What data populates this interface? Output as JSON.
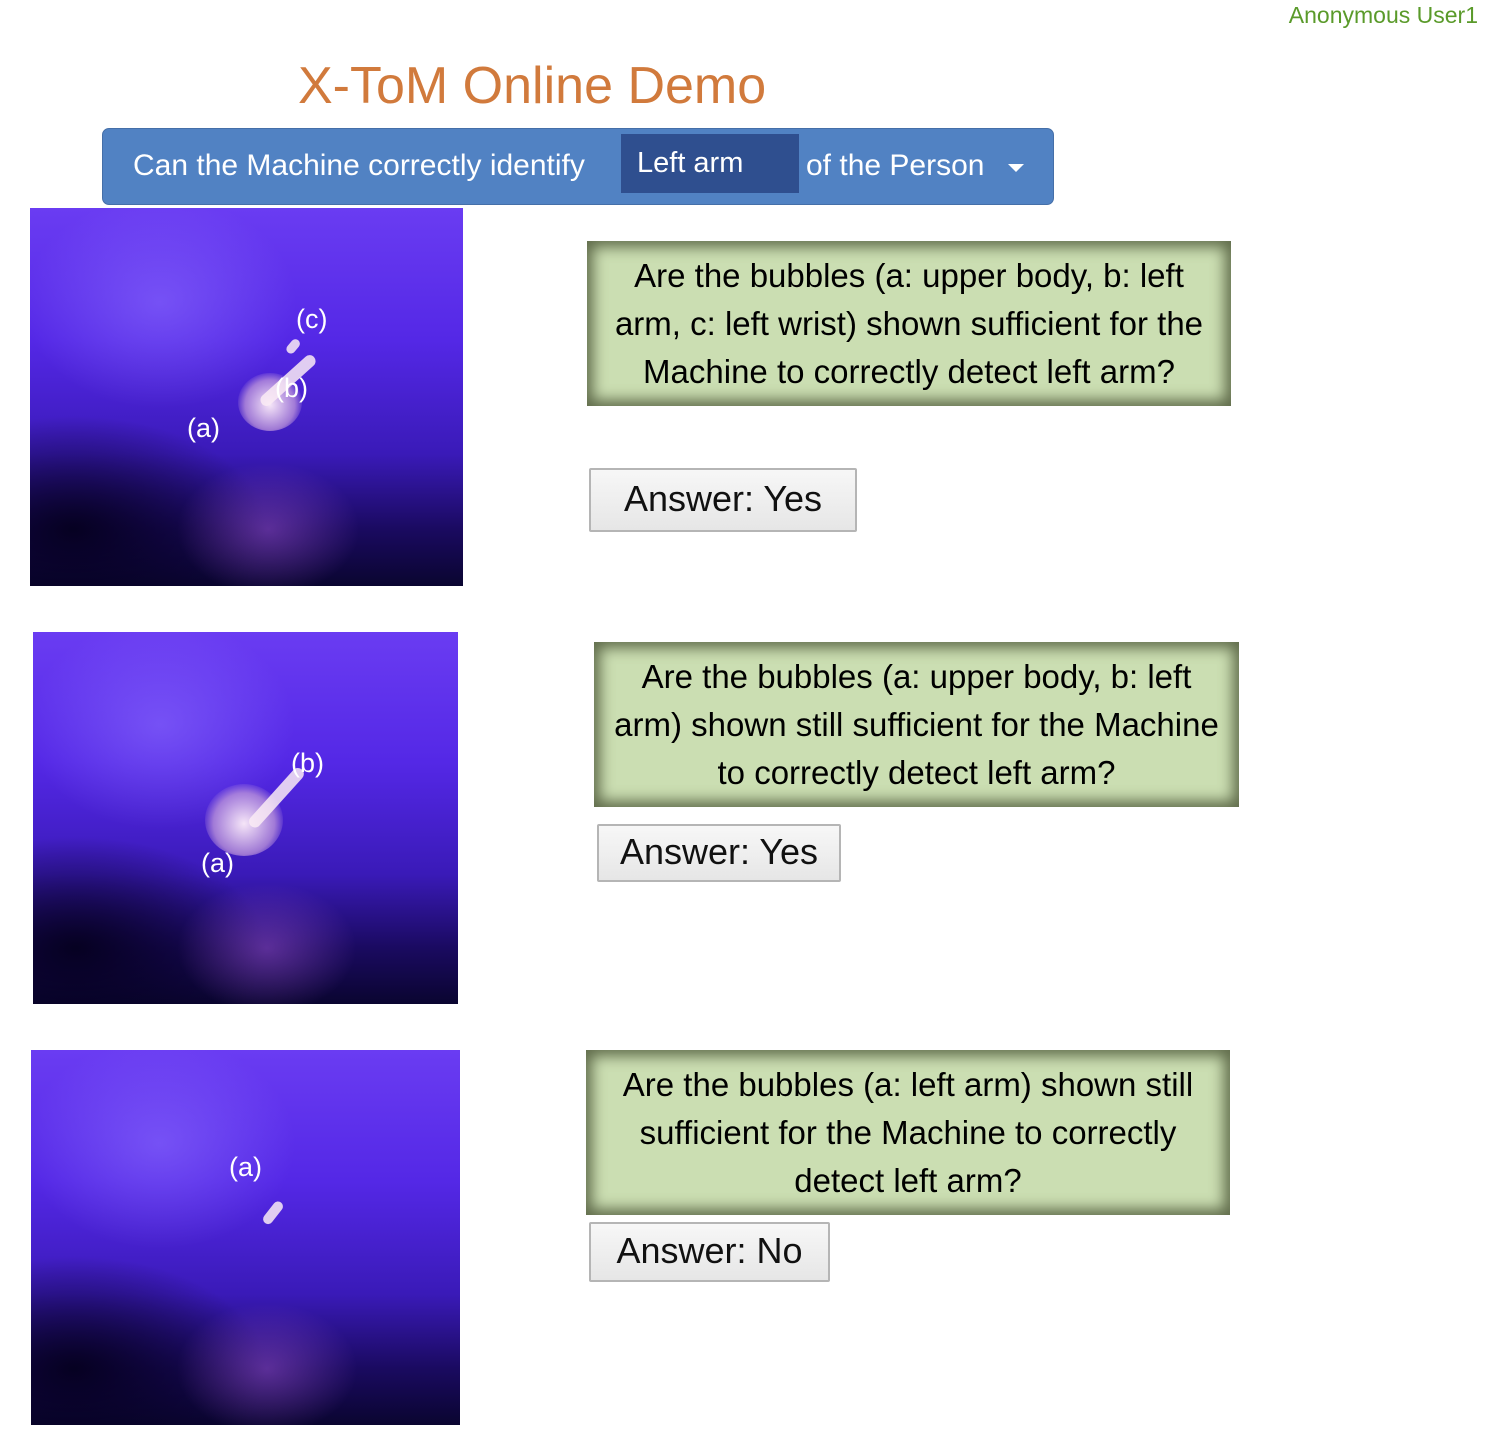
{
  "header": {
    "user": "Anonymous User1",
    "title": "X-ToM Online Demo"
  },
  "query": {
    "prefix": "Can the Machine correctly identify",
    "selected_part": "Left arm",
    "suffix": "of the Person",
    "dropdown_icon": "caret-down-icon"
  },
  "rows": [
    {
      "bubble_labels": [
        "(c)",
        "(b)",
        "(a)"
      ],
      "question": "Are the bubbles (a: upper body, b: left arm, c: left wrist) shown sufficient for the Machine to correctly detect left arm?",
      "answer": "Answer: Yes"
    },
    {
      "bubble_labels": [
        "(b)",
        "(a)"
      ],
      "question": "Are the bubbles (a: upper body, b: left arm) shown still sufficient for the Machine to correctly detect left arm?",
      "answer": "Answer: Yes"
    },
    {
      "bubble_labels": [
        "(a)"
      ],
      "question": "Are the bubbles (a: left arm) shown still sufficient for the Machine to correctly detect left arm?",
      "answer": "Answer: No"
    }
  ],
  "colors": {
    "title": "#d17a3c",
    "user": "#5a9a2a",
    "query_bar": "#5182c3",
    "selected_part_bg": "#2f4f8f",
    "question_box": "#cbdeb2"
  }
}
